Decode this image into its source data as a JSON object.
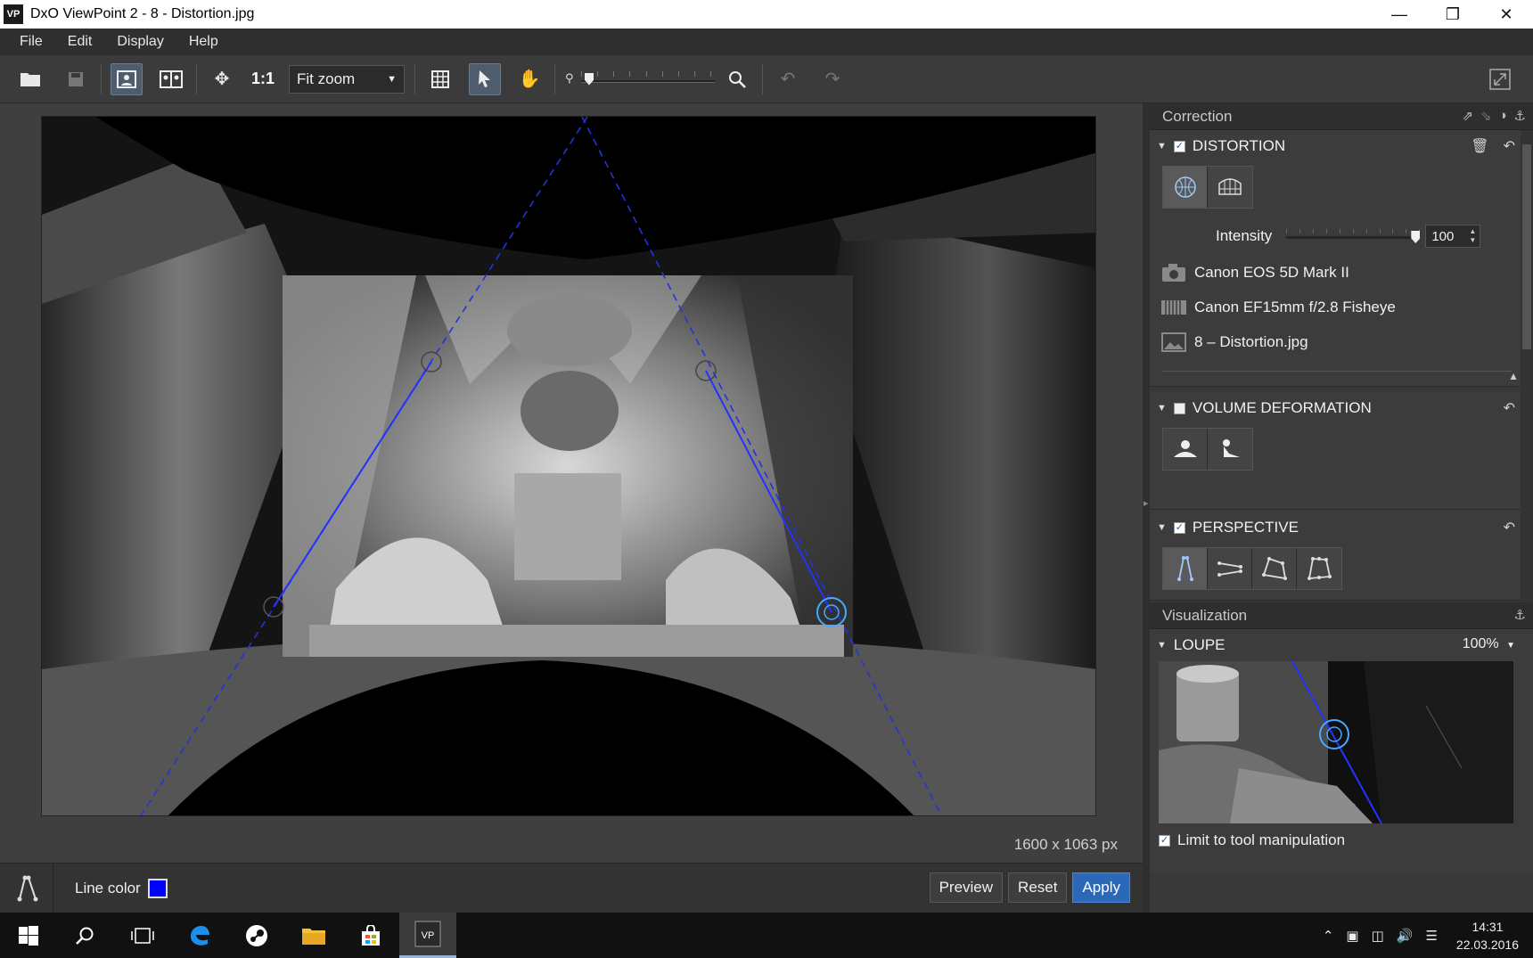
{
  "window": {
    "app_icon": "VP",
    "title": "DxO ViewPoint 2 - 8 - Distortion.jpg",
    "controls": [
      "minimize-icon",
      "maximize-icon",
      "close-icon"
    ]
  },
  "menu": [
    "File",
    "Edit",
    "Display",
    "Help"
  ],
  "toolbar": {
    "one_to_one": "1:1",
    "zoom_value": "Fit zoom",
    "icons": [
      "open-folder-icon",
      "save-icon",
      "single-view-icon",
      "compare-view-icon",
      "move-icon",
      "grid-icon",
      "select-arrow-icon",
      "hand-icon",
      "zoom-out-icon",
      "zoom-in-icon",
      "undo-icon",
      "redo-icon",
      "fullscreen-icon"
    ]
  },
  "canvas": {
    "image_size": "1600 x 1063 px"
  },
  "bottom": {
    "line_color_label": "Line color",
    "line_color": "#0000ff",
    "preview": "Preview",
    "reset": "Reset",
    "apply": "Apply"
  },
  "correction": {
    "header": "Correction",
    "distortion": {
      "title": "DISTORTION",
      "enabled": true,
      "intensity_label": "Intensity",
      "intensity_value": "100",
      "intensity_level": 1.0,
      "camera": "Canon EOS 5D Mark II",
      "lens": "Canon EF15mm f/2.8 Fisheye",
      "file": "8 – Distortion.jpg"
    },
    "volume": {
      "title": "VOLUME DEFORMATION",
      "enabled": false
    },
    "perspective": {
      "title": "PERSPECTIVE",
      "enabled": true
    }
  },
  "visualization": {
    "header": "Visualization",
    "loupe_title": "LOUPE",
    "loupe_zoom": "100%",
    "limit_label": "Limit to tool manipulation",
    "limit_checked": true
  },
  "taskbar": {
    "time": "14:31",
    "date": "22.03.2016",
    "accent": "#9ab3d4"
  }
}
